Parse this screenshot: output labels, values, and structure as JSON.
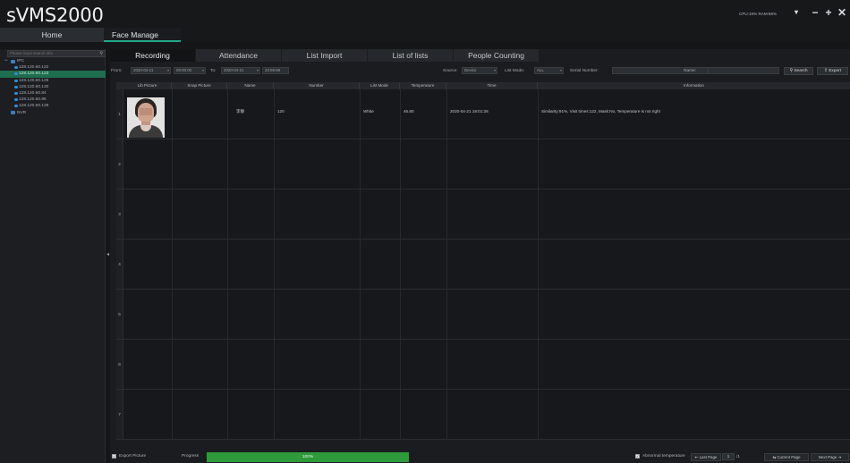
{
  "app": {
    "title": "sVMS2000",
    "sysinfo": "CPU:19% RAM:86%"
  },
  "topnav": {
    "home": "Home",
    "face_manage": "Face Manage"
  },
  "window": {
    "menu": "▾",
    "minimize": "−",
    "maximize": "+",
    "close": "✕"
  },
  "left": {
    "search_placeholder": "Please input search info",
    "tree": [
      {
        "label": "IPC",
        "type": "root",
        "toggle": "−"
      },
      {
        "label": "128.120.60.122",
        "type": "cam",
        "selected": false
      },
      {
        "label": "128.120.60.123",
        "type": "cam",
        "selected": true
      },
      {
        "label": "128.120.60.125",
        "type": "cam",
        "selected": false
      },
      {
        "label": "128.120.60.130",
        "type": "cam",
        "selected": false
      },
      {
        "label": "128.120.60.84",
        "type": "cam",
        "selected": false
      },
      {
        "label": "128.120.60.85",
        "type": "cam",
        "selected": false
      },
      {
        "label": "128.120.60.128",
        "type": "cam",
        "selected": false
      },
      {
        "label": "NVR",
        "type": "root",
        "toggle": ""
      }
    ]
  },
  "subtabs": [
    "Recording",
    "Attendance",
    "List Import",
    "List of lists",
    "People Counting"
  ],
  "filter": {
    "from_label": "From:",
    "from_date": "2020-04-21",
    "from_time": "00:00:00",
    "to_label": "To:",
    "to_date": "2020-04-21",
    "to_time": "23:59:59",
    "source_label": "Source:",
    "source_value": "Device",
    "list_mode_label": "List Mode:",
    "list_mode_value": "ALL",
    "serial_label": "Serial Number:",
    "serial_value": "",
    "name_label": "Name:",
    "name_value": "",
    "search_button": "Search",
    "export_button": "Export"
  },
  "table": {
    "headers": [
      "Lib Picture",
      "Snap Picture",
      "Name",
      "Number",
      "List Mode",
      "Temperature",
      "Time",
      "Information"
    ],
    "rows": [
      {
        "index": "1",
        "name": "李静",
        "number": "120",
        "list_mode": "White",
        "temperature": "46.80",
        "time": "2020-04-21 18:01:28",
        "info": "Similarity:91%, Visit times:122, Mask:No, Temperature is not right"
      },
      {
        "index": "2"
      },
      {
        "index": "3"
      },
      {
        "index": "4"
      },
      {
        "index": "5"
      },
      {
        "index": "6"
      },
      {
        "index": "7"
      }
    ]
  },
  "bottom": {
    "export_picture": "Export Picture",
    "progress_label": "Progress",
    "progress_text": "100%",
    "progress_value": 100,
    "abnormal_temp": "Abnormal temperature",
    "last_page": "Last Page",
    "page_value": "1",
    "page_total": "/1",
    "current_page": "Current Page",
    "next_page": "Next Page"
  },
  "colors": {
    "accent": "#21a88a",
    "selected": "#1f6e4f",
    "progress": "#2e9a3a"
  }
}
